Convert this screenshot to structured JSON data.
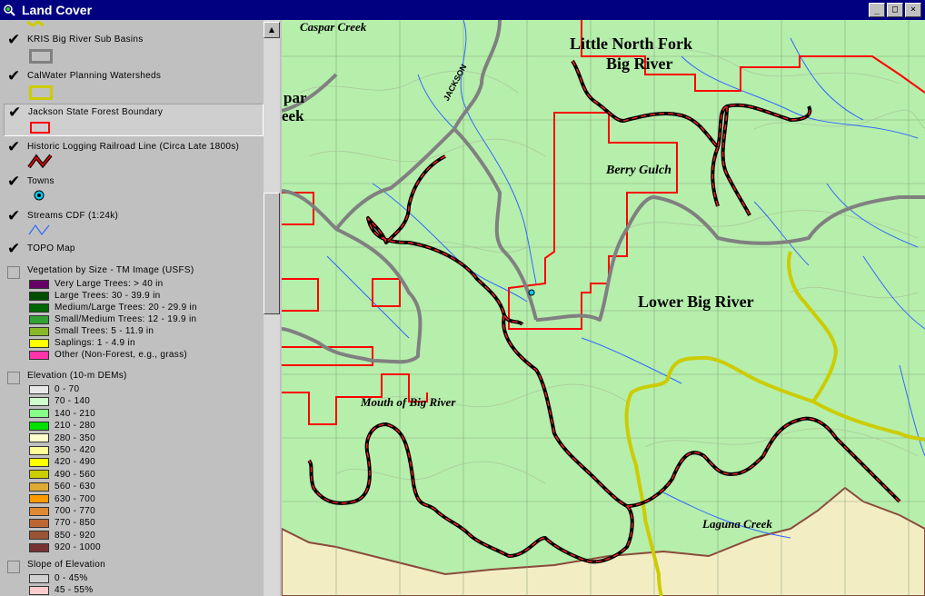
{
  "window": {
    "title": "Land Cover",
    "minimize_symbol": "_",
    "maximize_symbol": "□",
    "close_symbol": "×"
  },
  "legend": {
    "layers": [
      {
        "name": "KRIS Big River Sub Basins",
        "checked": true,
        "symbol": "gray-outline",
        "color": "#808080"
      },
      {
        "name": "CalWater Planning Watersheds",
        "checked": true,
        "symbol": "yellow-outline",
        "color": "#cccc00"
      },
      {
        "name": "Jackson State Forest Boundary",
        "checked": true,
        "symbol": "red-outline",
        "color": "#ff0000"
      },
      {
        "name": "Historic Logging Railroad Line (Circa Late 1800s)",
        "checked": true,
        "symbol": "railroad-line"
      },
      {
        "name": "Towns",
        "checked": true,
        "symbol": "town-point"
      },
      {
        "name": "Streams CDF (1:24k)",
        "checked": true,
        "symbol": "stream-line",
        "color": "#3366ff"
      },
      {
        "name": "TOPO Map",
        "checked": true
      },
      {
        "name": "Vegetation by Size - TM Image (USFS)",
        "checked": false,
        "classes": [
          {
            "label": "Very Large Trees: > 40  in",
            "color": "#660066"
          },
          {
            "label": "Large Trees: 30 - 39.9 in",
            "color": "#004d00"
          },
          {
            "label": "Medium/Large Trees: 20 - 29.9 in",
            "color": "#006600"
          },
          {
            "label": "Small/Medium Trees: 12 - 19.9 in",
            "color": "#33a033"
          },
          {
            "label": "Small Trees: 5 - 11.9 in",
            "color": "#88b82a"
          },
          {
            "label": "Saplings: 1 - 4.9 in",
            "color": "#ffff00"
          },
          {
            "label": "Other (Non-Forest, e.g., grass)",
            "color": "#ff33aa"
          }
        ]
      },
      {
        "name": "Elevation (10-m DEMs)",
        "checked": false,
        "classes": [
          {
            "label": "0 - 70",
            "color": "#e8e8e8"
          },
          {
            "label": "70 - 140",
            "color": "#ccffcc"
          },
          {
            "label": "140 - 210",
            "color": "#88ff88"
          },
          {
            "label": "210 - 280",
            "color": "#00e000"
          },
          {
            "label": "280 - 350",
            "color": "#ffffcc"
          },
          {
            "label": "350 - 420",
            "color": "#ffff99"
          },
          {
            "label": "420 - 490",
            "color": "#ffff00"
          },
          {
            "label": "490 - 560",
            "color": "#cccc00"
          },
          {
            "label": "560 - 630",
            "color": "#ddaa33"
          },
          {
            "label": "630 - 700",
            "color": "#ff9900"
          },
          {
            "label": "700 - 770",
            "color": "#dd8833"
          },
          {
            "label": "770 - 850",
            "color": "#bb6633"
          },
          {
            "label": "850 - 920",
            "color": "#995533"
          },
          {
            "label": "920 - 1000",
            "color": "#773333"
          }
        ]
      },
      {
        "name": "Slope of Elevation",
        "checked": false,
        "classes": [
          {
            "label": "0 - 45%",
            "color": "#d0d0d0"
          },
          {
            "label": "45 - 55%",
            "color": "#ffcccc"
          }
        ]
      }
    ]
  },
  "map": {
    "labels": {
      "caspar_creek": "Caspar Creek",
      "little_north_fork_1": "Little North Fork",
      "little_north_fork_2": "Big River",
      "caspar_partial_1": "par",
      "caspar_partial_2": "eek",
      "berry_gulch": "Berry Gulch",
      "lower_big_river": "Lower Big River",
      "mouth_of_big_river": "Mouth of Big River",
      "laguna_creek": "Laguna Creek",
      "jackson_road": "JACKSON"
    },
    "colors": {
      "topo_bg": "#b6eeac",
      "grid": "#7a9a74",
      "stream": "#3366ff",
      "subbasin": "#808080",
      "watershed": "#cccc00",
      "forest_boundary": "#ff0000",
      "railroad": "#000000",
      "coast": "#f5f0c8"
    }
  }
}
